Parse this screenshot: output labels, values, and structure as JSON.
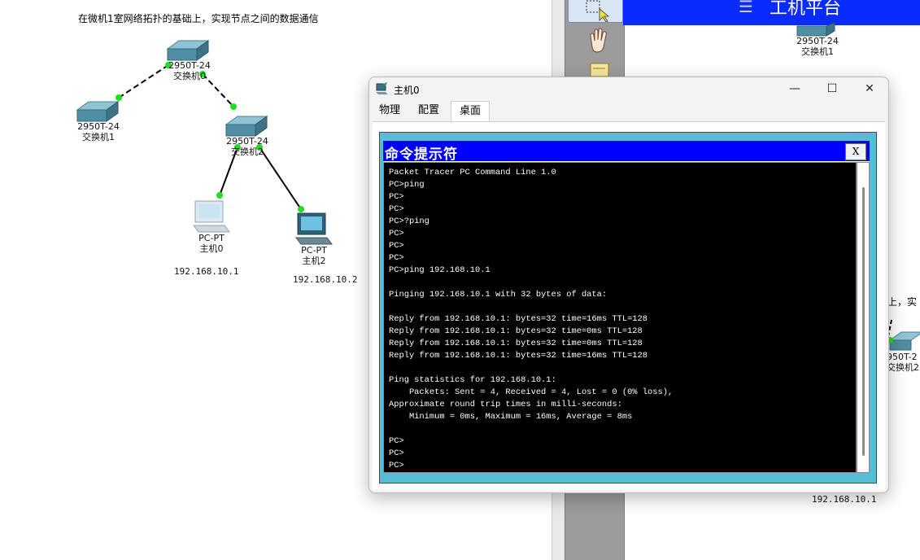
{
  "topology": {
    "title": "在微机1室网络拓扑的基础上，实现节点之间的数据通信",
    "devices": [
      {
        "id": "sw0",
        "model": "2950T-24",
        "name": "交换机0",
        "icon": "switch-icon"
      },
      {
        "id": "sw1",
        "model": "2950T-24",
        "name": "交换机1",
        "icon": "switch-icon"
      },
      {
        "id": "sw2",
        "model": "2950T-24",
        "name": "交换机2",
        "icon": "switch-icon"
      },
      {
        "id": "pc0",
        "model": "PC-PT",
        "name": "主机0",
        "ip": "192.168.10.1",
        "icon": "pc-icon"
      },
      {
        "id": "pc2",
        "model": "PC-PT",
        "name": "主机2",
        "ip": "192.168.10.2",
        "icon": "pc-icon"
      }
    ]
  },
  "background_right": {
    "banner_text": "工机平台",
    "device_model": "2950T-24",
    "device_name": "交换机1",
    "partial_title": "上，实",
    "partial_switch_model": "950T-2",
    "partial_switch_name": "交换机2",
    "ip": "192.168.10.1"
  },
  "tool_panel": {
    "tools": [
      "select-tool-icon",
      "hand-tool-icon",
      "note-tool-icon"
    ]
  },
  "dialog": {
    "title": "主机0",
    "icon": "pc-app-icon",
    "tabs": [
      "物理",
      "配置",
      "桌面"
    ],
    "active_tab": "桌面",
    "controls": {
      "minimize": "—",
      "maximize": "☐",
      "close": "✕"
    },
    "cmd": {
      "title": "命令提示符",
      "close_label": "X",
      "lines": [
        "Packet Tracer PC Command Line 1.0",
        "PC>ping",
        "PC>",
        "PC>",
        "PC>?ping",
        "PC>",
        "PC>",
        "PC>",
        "PC>ping 192.168.10.1",
        "",
        "Pinging 192.168.10.1 with 32 bytes of data:",
        "",
        "Reply from 192.168.10.1: bytes=32 time=16ms TTL=128",
        "Reply from 192.168.10.1: bytes=32 time=0ms TTL=128",
        "Reply from 192.168.10.1: bytes=32 time=0ms TTL=128",
        "Reply from 192.168.10.1: bytes=32 time=16ms TTL=128",
        "",
        "Ping statistics for 192.168.10.1:",
        "    Packets: Sent = 4, Received = 4, Lost = 0 (0% loss),",
        "Approximate round trip times in milli-seconds:",
        "    Minimum = 0ms, Maximum = 16ms, Average = 8ms",
        "",
        "PC>",
        "PC>",
        "PC>"
      ]
    }
  },
  "colors": {
    "cmd_title_bar": "#0000ff",
    "desktop_bg": "#57bcd6",
    "console_bg": "#000000",
    "link_dot": "#22dd22",
    "banner": "#0a2bff"
  }
}
